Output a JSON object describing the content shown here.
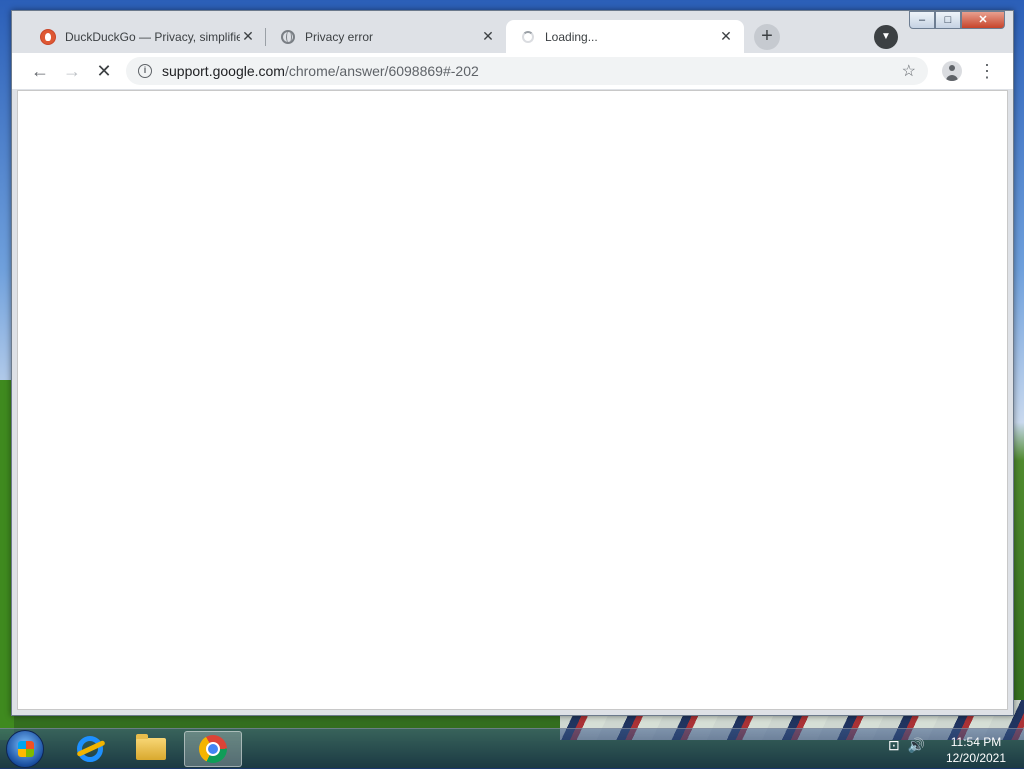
{
  "browser": {
    "tabs": [
      {
        "title": "DuckDuckGo — Privacy, simplified.",
        "favicon": "duckduckgo-icon",
        "state": "inactive"
      },
      {
        "title": "Privacy error",
        "favicon": "globe-icon",
        "state": "inactive"
      },
      {
        "title": "Loading...",
        "favicon": "loading-spinner-icon",
        "state": "active"
      }
    ],
    "new_tab_label": "+",
    "close_glyph": "✕",
    "address": {
      "host": "support.google.com",
      "path": "/chrome/answer/6098869#-202"
    }
  },
  "window_controls": {
    "minimize": "–",
    "maximize": "□",
    "close": "✕"
  },
  "taskbar": {
    "items": [
      "internet-explorer-icon",
      "file-explorer-icon",
      "chrome-icon"
    ],
    "clock": {
      "time": "11:54 PM",
      "date": "12/20/2021"
    }
  }
}
